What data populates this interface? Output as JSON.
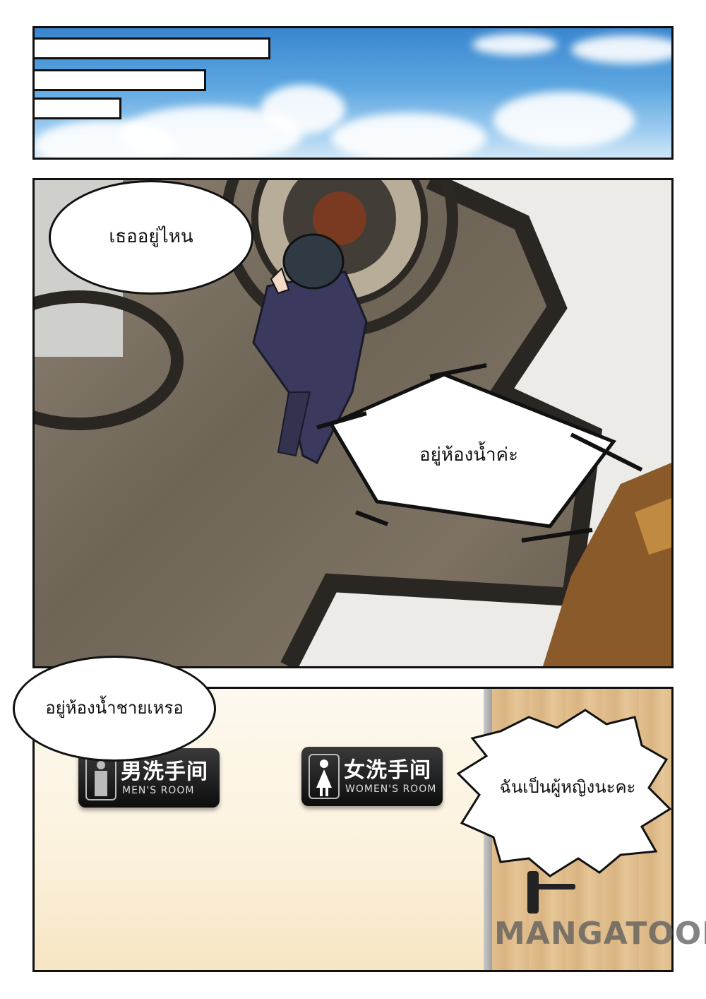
{
  "panel2": {
    "bubble_top": "เธออยู่ไหน",
    "bubble_shout": "อยู่ห้องน้ำค่ะ"
  },
  "panel3": {
    "bubble_left": "อยู่ห้องน้ำชายเหรอ",
    "bubble_right": "ฉันเป็นผู้หญิงนะคะ",
    "sign_men": {
      "zh": "男洗手间",
      "en": "MEN'S ROOM"
    },
    "sign_women": {
      "zh": "女洗手间",
      "en": "WOMEN'S ROOM"
    }
  },
  "watermark": "MANGATOON",
  "colors": {
    "sky": "#4a96d8",
    "floor": "#7a6f60",
    "marble": "#e8e8e6",
    "wood": "#dcb888",
    "ink": "#111111"
  }
}
